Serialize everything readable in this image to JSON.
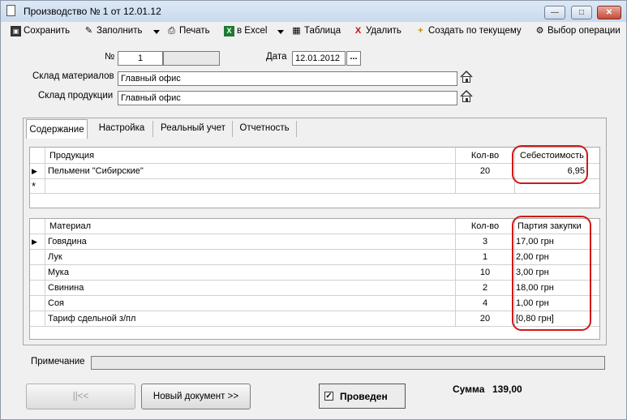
{
  "window": {
    "title": "Производство № 1 от 12.01.12"
  },
  "toolbar": {
    "save": "Сохранить",
    "fill": "Заполнить",
    "print": "Печать",
    "excel": "в Excel",
    "table": "Таблица",
    "delete": "Удалить",
    "create_from": "Создать по текущему",
    "select_op": "Выбор операции"
  },
  "header": {
    "number_label": "№",
    "number_value": "1",
    "date_label": "Дата",
    "date_value": "12.01.2012",
    "date_picker": "...",
    "materials_wh_label": "Склад материалов",
    "materials_wh_value": "Главный офис",
    "products_wh_label": "Склад продукции",
    "products_wh_value": "Главный офис"
  },
  "tabs": [
    "Содержание",
    "Настройка",
    "Реальный учет",
    "Отчетность"
  ],
  "products": {
    "columns": [
      "Продукция",
      "Кол-во",
      "Себестоимость"
    ],
    "rows": [
      {
        "name": "Пельмени \"Сибирские\"",
        "qty": "20",
        "cost": "6,95"
      }
    ],
    "new_row_marker": "*"
  },
  "materials": {
    "columns": [
      "Материал",
      "Кол-во",
      "Партия закупки"
    ],
    "rows": [
      {
        "name": "Говядина",
        "qty": "3",
        "batch": "17,00 грн"
      },
      {
        "name": "Лук",
        "qty": "1",
        "batch": "2,00 грн"
      },
      {
        "name": "Мука",
        "qty": "10",
        "batch": "3,00 грн"
      },
      {
        "name": "Свинина",
        "qty": "2",
        "batch": "18,00 грн"
      },
      {
        "name": "Соя",
        "qty": "4",
        "batch": "1,00 грн"
      },
      {
        "name": "Тариф сдельной з/пл",
        "qty": "20",
        "batch": "[0,80 грн]"
      }
    ]
  },
  "note": {
    "label": "Примечание",
    "value": ""
  },
  "footer": {
    "first_button": "||<<",
    "new_doc_button": "Новый документ >>",
    "posted_label": "Проведен",
    "posted_checked": true,
    "sum_label": "Сумма",
    "sum_value": "139,00"
  },
  "colors": {
    "highlight": "#d01818",
    "title_bg": "#c9daee",
    "close_btn": "#c74a38"
  }
}
